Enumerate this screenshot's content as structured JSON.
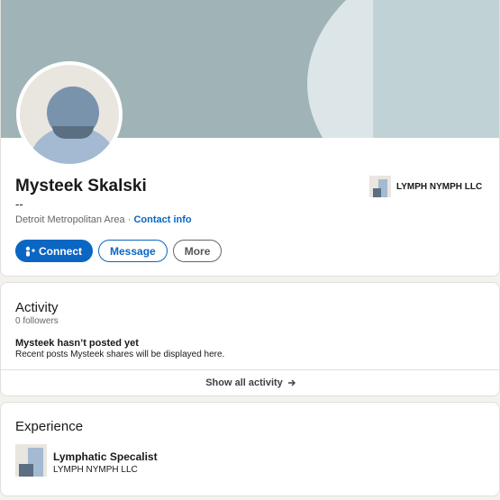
{
  "profile": {
    "name": "Mysteek Skalski",
    "headline": "--",
    "location": "Detroit Metropolitan Area",
    "separator": " · ",
    "contact_info_label": "Contact info",
    "company": {
      "name": "LYMPH NYMPH LLC",
      "logo_icon": "company-logo-icon"
    },
    "avatar_icon": "person-silhouette-icon",
    "actions": {
      "connect_label": "Connect",
      "connect_icon": "add-person-icon",
      "message_label": "Message",
      "more_label": "More"
    }
  },
  "activity": {
    "title": "Activity",
    "followers": "0 followers",
    "empty_title": "Mysteek hasn’t posted yet",
    "empty_subtitle": "Recent posts Mysteek shares will be displayed here.",
    "show_all_label": "Show all activity",
    "show_all_icon": "arrow-right-icon"
  },
  "experience": {
    "title": "Experience",
    "items": [
      {
        "title": "Lymphatic Specalist",
        "company": "LYMPH NYMPH LLC",
        "logo_icon": "company-logo-icon"
      }
    ]
  },
  "colors": {
    "accent": "#0a66c2",
    "banner": "#a0b4b7",
    "page_background": "#f3f2ef",
    "card_background": "#ffffff",
    "muted_text": "#666666"
  }
}
